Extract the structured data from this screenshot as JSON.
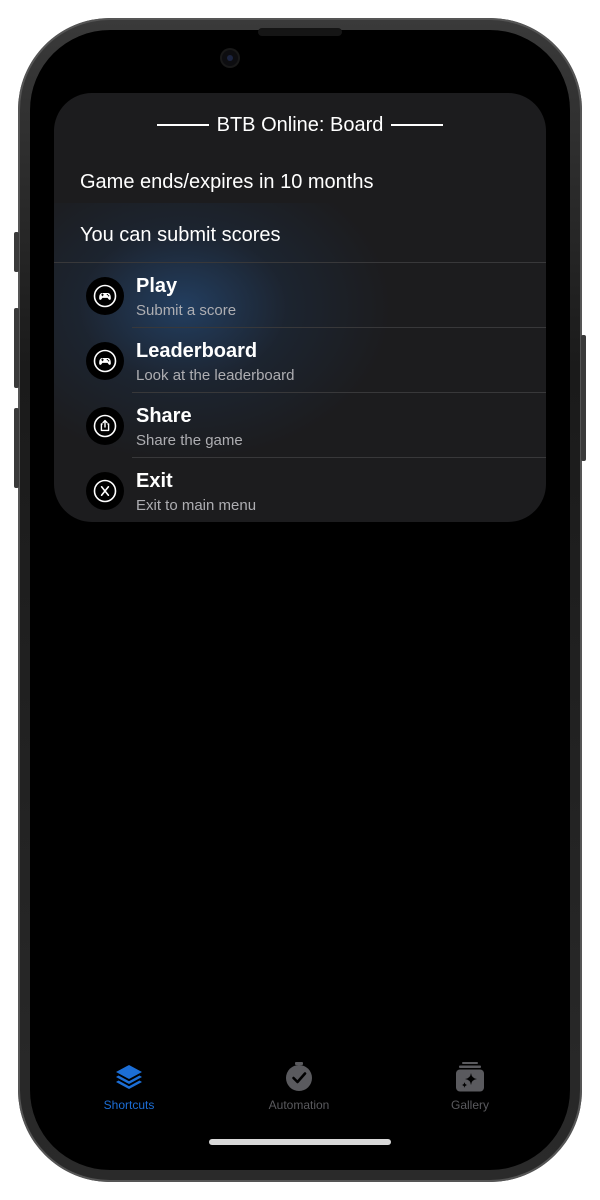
{
  "card": {
    "title": "BTB Online: Board",
    "lines": [
      "Game ends/expires in 10 months",
      "You can submit scores"
    ],
    "menu": [
      {
        "icon": "gamepad-icon",
        "label": "Play",
        "subtitle": "Submit a score"
      },
      {
        "icon": "gamepad-icon",
        "label": "Leaderboard",
        "subtitle": "Look at the leaderboard"
      },
      {
        "icon": "share-icon",
        "label": "Share",
        "subtitle": "Share the game"
      },
      {
        "icon": "x-circle-icon",
        "label": "Exit",
        "subtitle": "Exit to main menu"
      }
    ]
  },
  "tabbar": {
    "tabs": [
      {
        "label": "Shortcuts",
        "icon": "layers-icon",
        "active": true
      },
      {
        "label": "Automation",
        "icon": "clock-check-icon",
        "active": false
      },
      {
        "label": "Gallery",
        "icon": "sparkle-stack-icon",
        "active": false
      }
    ]
  },
  "colors": {
    "accent": "#1c6ed6",
    "inactive_tab": "#5a5a5e",
    "card_bg": "#1c1c1e",
    "subtitle": "#aeaeb2"
  }
}
